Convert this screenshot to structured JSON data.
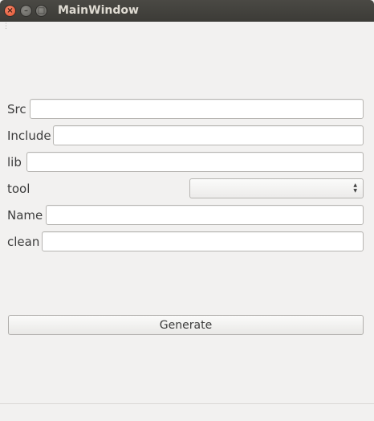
{
  "window": {
    "title": "MainWindow"
  },
  "form": {
    "src_label": "Src",
    "src_value": "",
    "include_label": "Include",
    "include_value": "",
    "lib_label": "lib",
    "lib_value": "",
    "tool_label": "tool",
    "tool_value": "",
    "name_label": "Name",
    "name_value": "",
    "clean_label": "clean",
    "clean_value": ""
  },
  "actions": {
    "generate_label": "Generate"
  },
  "colors": {
    "titlebar": "#3c3b37",
    "close": "#e2522f",
    "background": "#f2f1f0"
  }
}
